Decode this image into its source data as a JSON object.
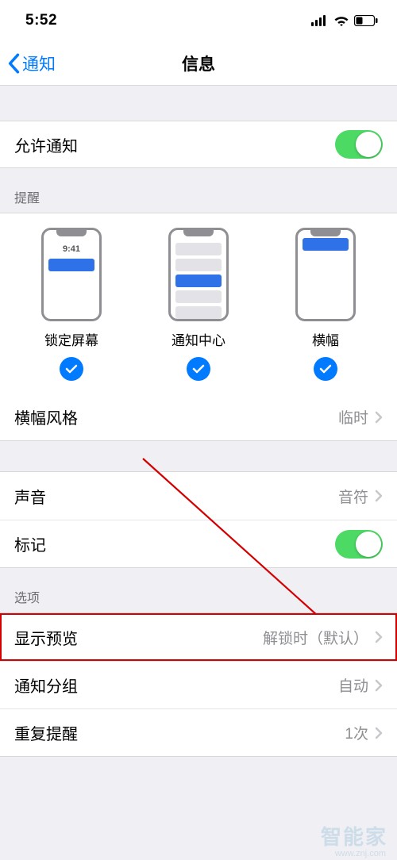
{
  "status": {
    "time": "5:52"
  },
  "nav": {
    "back": "通知",
    "title": "信息"
  },
  "allow": {
    "label": "允许通知",
    "on": true
  },
  "alerts": {
    "header": "提醒",
    "lock": {
      "label": "锁定屏幕",
      "time": "9:41",
      "checked": true
    },
    "center": {
      "label": "通知中心",
      "checked": true
    },
    "banner": {
      "label": "横幅",
      "checked": true
    }
  },
  "banner_style": {
    "label": "横幅风格",
    "value": "临时"
  },
  "sound": {
    "label": "声音",
    "value": "音符"
  },
  "badge": {
    "label": "标记",
    "on": true
  },
  "options": {
    "header": "选项",
    "preview": {
      "label": "显示预览",
      "value": "解锁时（默认）"
    },
    "grouping": {
      "label": "通知分组",
      "value": "自动"
    },
    "repeat": {
      "label": "重复提醒",
      "value": "1次"
    }
  },
  "watermark": {
    "brand": "智能家",
    "url": "www.znj.com"
  }
}
